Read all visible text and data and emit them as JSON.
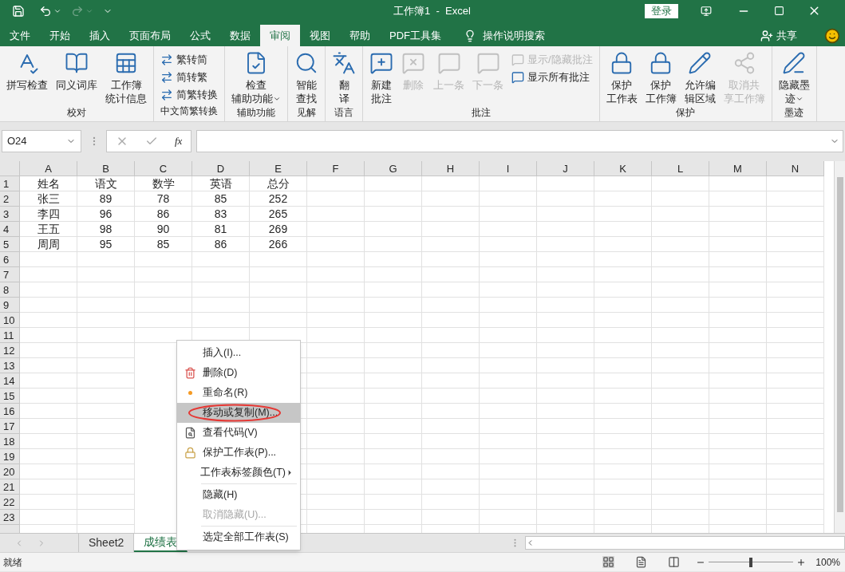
{
  "title_bar": {
    "title": "工作簿1  -  Excel",
    "login": "登录"
  },
  "menu_tabs": [
    {
      "label": "文件",
      "selected": false
    },
    {
      "label": "开始",
      "selected": false
    },
    {
      "label": "插入",
      "selected": false
    },
    {
      "label": "页面布局",
      "selected": false
    },
    {
      "label": "公式",
      "selected": false
    },
    {
      "label": "数据",
      "selected": false
    },
    {
      "label": "审阅",
      "selected": true
    },
    {
      "label": "视图",
      "selected": false
    },
    {
      "label": "帮助",
      "selected": false
    },
    {
      "label": "PDF工具集",
      "selected": false
    }
  ],
  "tell_me": "操作说明搜索",
  "share": "共享",
  "ribbon_groups": [
    {
      "label": "校对",
      "buttons": [
        {
          "kind": "large",
          "lines": [
            "拼写检查"
          ],
          "disabled": false
        },
        {
          "kind": "large",
          "lines": [
            "同义词库"
          ],
          "disabled": false
        },
        {
          "kind": "large",
          "lines": [
            "工作簿",
            "统计信息"
          ],
          "disabled": false
        }
      ]
    },
    {
      "label": "中文简繁转换",
      "buttons": [
        {
          "kind": "small",
          "lines": [
            "繁转简"
          ],
          "disabled": false
        },
        {
          "kind": "small",
          "lines": [
            "简转繁"
          ],
          "disabled": false
        },
        {
          "kind": "small",
          "lines": [
            "简繁转换"
          ],
          "disabled": false
        }
      ]
    },
    {
      "label": "辅助功能",
      "buttons": [
        {
          "kind": "large",
          "lines": [
            "检查",
            "辅助功能"
          ],
          "disabled": false,
          "dropdown": true
        }
      ]
    },
    {
      "label": "见解",
      "buttons": [
        {
          "kind": "large",
          "lines": [
            "智能",
            "查找"
          ],
          "disabled": false
        }
      ]
    },
    {
      "label": "语言",
      "buttons": [
        {
          "kind": "large",
          "lines": [
            "翻",
            "译"
          ],
          "disabled": false
        }
      ]
    },
    {
      "label": "批注",
      "buttons": [
        {
          "kind": "large",
          "lines": [
            "新建",
            "批注"
          ],
          "disabled": false
        },
        {
          "kind": "large",
          "lines": [
            "删除"
          ],
          "disabled": true
        },
        {
          "kind": "large",
          "lines": [
            "上一条"
          ],
          "disabled": true
        },
        {
          "kind": "large",
          "lines": [
            "下一条"
          ],
          "disabled": true
        },
        {
          "kind": "small",
          "lines": [
            "显示/隐藏批注"
          ],
          "disabled": true
        },
        {
          "kind": "small",
          "lines": [
            "显示所有批注"
          ],
          "disabled": false
        }
      ]
    },
    {
      "label": "保护",
      "buttons": [
        {
          "kind": "large",
          "lines": [
            "保护",
            "工作表"
          ],
          "disabled": false
        },
        {
          "kind": "large",
          "lines": [
            "保护",
            "工作簿"
          ],
          "disabled": false
        },
        {
          "kind": "large",
          "lines": [
            "允许编",
            "辑区域"
          ],
          "disabled": false
        },
        {
          "kind": "large",
          "lines": [
            "取消共",
            "享工作簿"
          ],
          "disabled": true
        }
      ]
    },
    {
      "label": "墨迹",
      "buttons": [
        {
          "kind": "large",
          "lines": [
            "隐藏墨",
            "迹"
          ],
          "disabled": false,
          "dropdown": true
        }
      ]
    }
  ],
  "name_box": "O24",
  "formula_fx": "fx",
  "columns": [
    "A",
    "B",
    "C",
    "D",
    "E",
    "F",
    "G",
    "H",
    "I",
    "J",
    "K",
    "L",
    "M",
    "N"
  ],
  "rows": [
    {
      "number": "1",
      "cells": [
        "姓名",
        "语文",
        "数学",
        "英语",
        "总分"
      ]
    },
    {
      "number": "2",
      "cells": [
        "张三",
        "89",
        "78",
        "85",
        "252"
      ]
    },
    {
      "number": "3",
      "cells": [
        "李四",
        "96",
        "86",
        "83",
        "265"
      ]
    },
    {
      "number": "4",
      "cells": [
        "王五",
        "98",
        "90",
        "81",
        "269"
      ]
    },
    {
      "number": "5",
      "cells": [
        "周周",
        "95",
        "85",
        "86",
        "266"
      ]
    },
    {
      "number": "6"
    },
    {
      "number": "7"
    },
    {
      "number": "8"
    },
    {
      "number": "9"
    },
    {
      "number": "10"
    },
    {
      "number": "11"
    },
    {
      "number": "12"
    },
    {
      "number": "13"
    },
    {
      "number": "14"
    },
    {
      "number": "15"
    },
    {
      "number": "16"
    },
    {
      "number": "17"
    },
    {
      "number": "18"
    },
    {
      "number": "19"
    },
    {
      "number": "20"
    },
    {
      "number": "21"
    },
    {
      "number": "22"
    },
    {
      "number": "23"
    }
  ],
  "context_menu": [
    {
      "label": "插入(I)...",
      "disabled": false,
      "selected": false
    },
    {
      "label": "删除(D)",
      "disabled": false,
      "selected": false
    },
    {
      "label": "重命名(R)",
      "disabled": false,
      "selected": false
    },
    {
      "label": "移动或复制(M)...",
      "disabled": false,
      "selected": true
    },
    {
      "label": "查看代码(V)",
      "disabled": false,
      "selected": false
    },
    {
      "label": "保护工作表(P)...",
      "disabled": false,
      "selected": false
    },
    {
      "label": "工作表标签颜色(T)",
      "disabled": false,
      "selected": false,
      "submenu": true
    },
    {
      "label": "隐藏(H)",
      "disabled": false,
      "selected": false,
      "separator_before": true
    },
    {
      "label": "取消隐藏(U)...",
      "disabled": true,
      "selected": false
    },
    {
      "label": "选定全部工作表(S)",
      "disabled": false,
      "selected": false,
      "separator_before": true
    }
  ],
  "sheet_tabs": [
    {
      "label": "Sheet2",
      "selected": false
    },
    {
      "label": "成绩表",
      "selected": true
    }
  ],
  "status_bar": {
    "status": "就绪",
    "zoom": "100%",
    "zoom_slider": {
      "level": 0.5
    }
  }
}
